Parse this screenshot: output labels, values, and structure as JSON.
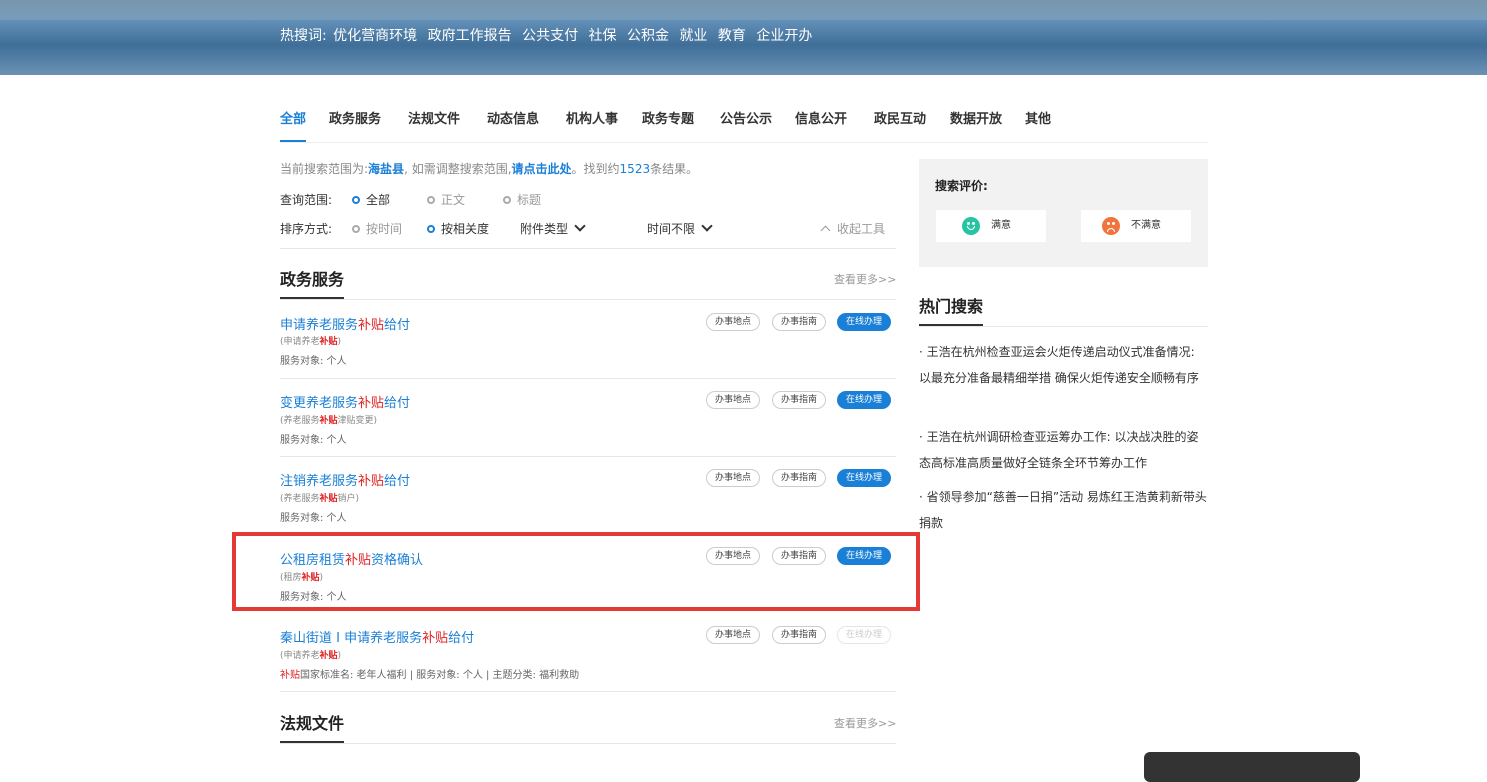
{
  "banner": {
    "hot_label": "热搜词:",
    "hot_words": [
      "优化营商环境",
      "政府工作报告",
      "公共支付",
      "社保",
      "公积金",
      "就业",
      "教育",
      "企业开办"
    ]
  },
  "tabs": [
    "全部",
    "政务服务",
    "法规文件",
    "动态信息",
    "机构人事",
    "政务专题",
    "公告公示",
    "信息公开",
    "政民互动",
    "数据开放",
    "其他"
  ],
  "scope": {
    "prefix": "当前搜索范围为:",
    "area": "海盐县",
    "mid": ", 如需调整搜索范围,",
    "link": "请点击此处",
    "found_pre": "。找到约",
    "count": "1523",
    "found_suf": "条结果。"
  },
  "filters": {
    "query_label": "查询范围:",
    "query_opts": [
      "全部",
      "正文",
      "标题"
    ],
    "sort_label": "排序方式:",
    "sort_opts": [
      "按时间",
      "按相关度"
    ],
    "attach": "附件类型",
    "time": "时间不限",
    "collapse": "收起工具"
  },
  "section1": {
    "title": "政务服务",
    "more": "查看更多>>",
    "items": [
      {
        "t1": "申请养老服务",
        "hl": "补贴",
        "t2": "给付",
        "s1": "(申请养老",
        "s2": "补贴",
        "s3": ")",
        "meta": "服务对象: 个人",
        "b1": "办事地点",
        "b2": "办事指南",
        "b3": "在线办理"
      },
      {
        "t1": "变更养老服务",
        "hl": "补贴",
        "t2": "给付",
        "s1": "(养老服务",
        "s2": "补贴",
        "s3": "津贴变更)",
        "meta": "服务对象: 个人",
        "b1": "办事地点",
        "b2": "办事指南",
        "b3": "在线办理"
      },
      {
        "t1": "注销养老服务",
        "hl": "补贴",
        "t2": "给付",
        "s1": "(养老服务",
        "s2": "补贴",
        "s3": "销户)",
        "meta": "服务对象: 个人",
        "b1": "办事地点",
        "b2": "办事指南",
        "b3": "在线办理"
      },
      {
        "t1": "公租房租赁",
        "hl": "补贴",
        "t2": "资格确认",
        "s1": "(租房",
        "s2": "补贴",
        "s3": ")",
        "meta": "服务对象: 个人",
        "b1": "办事地点",
        "b2": "办事指南",
        "b3": "在线办理"
      },
      {
        "t1": "秦山街道 I 申请养老服务",
        "hl": "补贴",
        "t2": "给付",
        "s1": "(申请养老",
        "s2": "补贴",
        "s3": ")",
        "meta_hl": "补贴",
        "meta": "国家标准名: 老年人福利 | 服务对象: 个人 | 主题分类: 福利救助",
        "b1": "办事地点",
        "b2": "办事指南",
        "b3": "在线办理"
      }
    ]
  },
  "section2": {
    "title": "法规文件",
    "more": "查看更多>>"
  },
  "eval": {
    "label": "搜索评价:",
    "good": "满意",
    "bad": "不满意"
  },
  "hot": {
    "title": "热门搜索",
    "items": [
      "· 王浩在杭州检查亚运会火炬传递启动仪式准备情况: 以最充分准备最精细举措 确保火炬传递安全顺畅有序",
      "· 王浩在杭州调研检查亚运筹办工作: 以决战决胜的姿态高标准高质量做好全链条全环节筹办工作",
      "· 省领导参加“慈善一日捐”活动 易炼红王浩黄莉新带头捐款"
    ]
  }
}
